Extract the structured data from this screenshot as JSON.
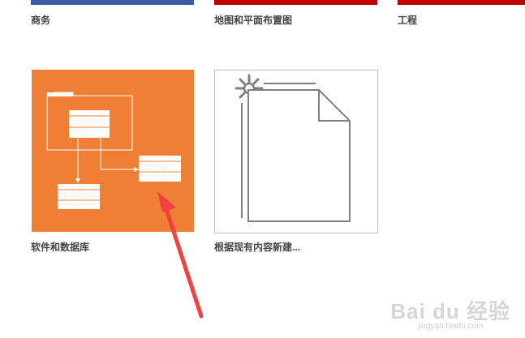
{
  "categories": [
    {
      "label": "商务",
      "color": "#3b5ba5"
    },
    {
      "label": "地图和平面布置图",
      "color": "#c00000"
    },
    {
      "label": "工程",
      "color": "#c00000"
    }
  ],
  "templates": [
    {
      "label": "软件和数据库",
      "color": "#ef7f34"
    },
    {
      "label": "根据现有内容新建..."
    }
  ],
  "watermark": {
    "brand": "Bai du 经验",
    "url": "jingyan.baidu.com"
  },
  "annotation": {
    "arrow_color": "#f04040"
  }
}
